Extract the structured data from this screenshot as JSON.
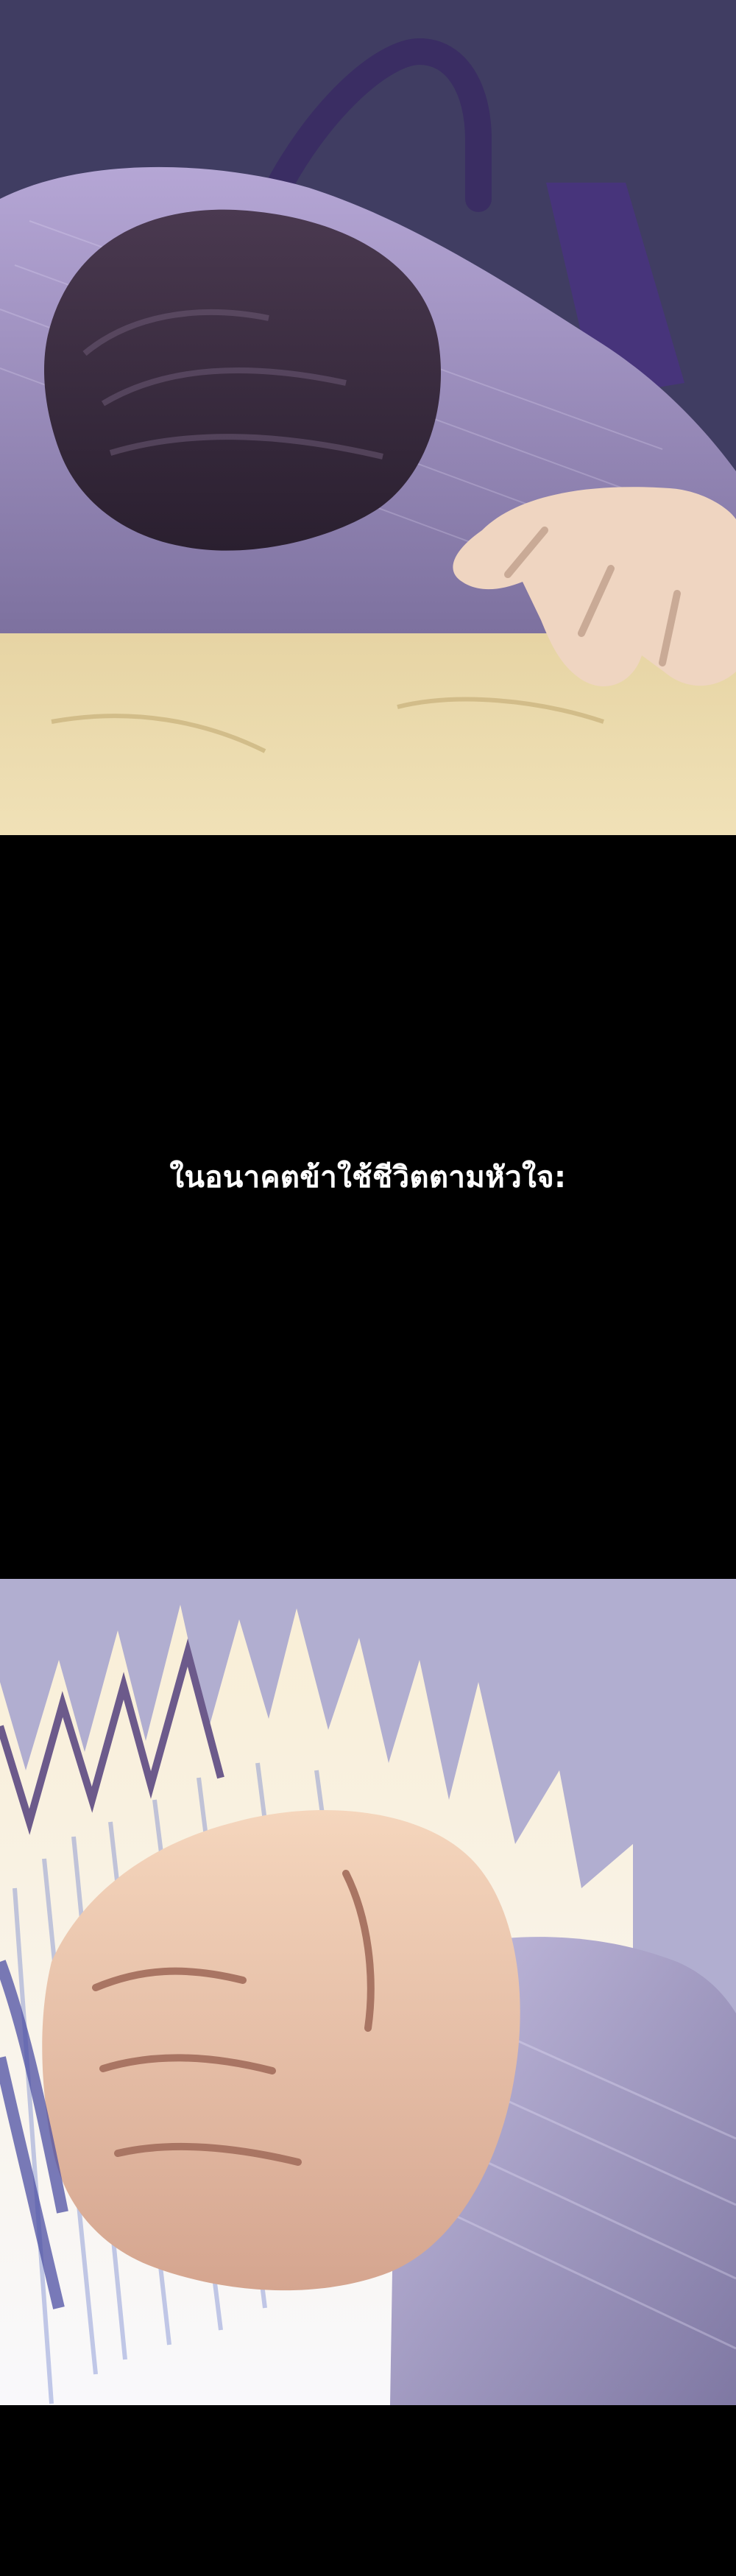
{
  "caption": {
    "text": "ในอนาคตข้าใช้ชีวิตตามหัวใจ:"
  },
  "colors": {
    "background": "#000000",
    "caption_text": "#ffffff",
    "top_shadow": "#3c3a5e",
    "sleeve": "#8d81b3",
    "floor": "#ecdcb0",
    "bottom_sky": "#8589c0"
  },
  "scenes": {
    "top": "character-lying-on-floor",
    "bottom": "clenched-fist"
  }
}
